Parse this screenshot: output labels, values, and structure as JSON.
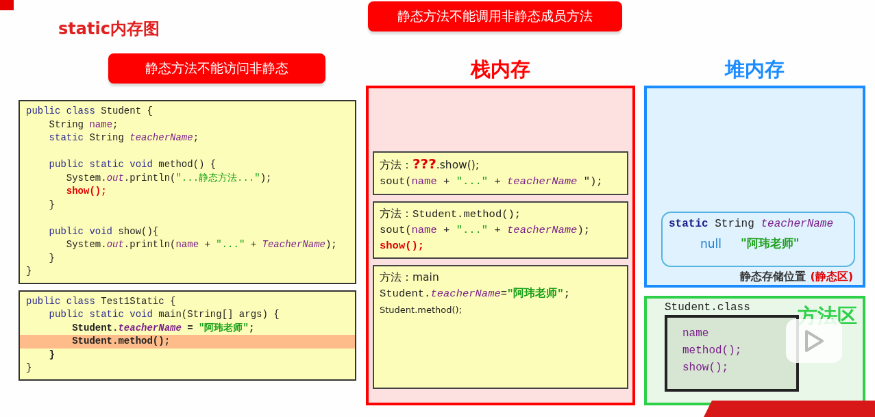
{
  "title": "static内存图",
  "left_banner": "静态方法不能访问非静态",
  "top_banner": "静态方法不能调用非静态成员方法",
  "code_blocks": [
    {
      "sections": [
        [
          {
            "highlighted": false,
            "tokens": [
              {
                "kind": "keyword",
                "text": "public class"
              },
              {
                "kind": "plain",
                "text": " Student {"
              }
            ]
          },
          {
            "highlighted": false,
            "tokens": [
              {
                "kind": "plain",
                "text": "    String "
              },
              {
                "kind": "field",
                "text": "name"
              },
              {
                "kind": "plain",
                "text": ";"
              }
            ]
          },
          {
            "highlighted": false,
            "tokens": [
              {
                "kind": "keyword",
                "text": "    static"
              },
              {
                "kind": "plain",
                "text": " String "
              },
              {
                "kind": "italic",
                "text": "teacherName"
              },
              {
                "kind": "plain",
                "text": ";"
              }
            ]
          }
        ],
        [
          {
            "highlighted": false,
            "tokens": [
              {
                "kind": "keyword",
                "text": "    public static void"
              },
              {
                "kind": "plain",
                "text": " method() {"
              }
            ]
          },
          {
            "highlighted": false,
            "tokens": [
              {
                "kind": "plain",
                "text": "       System."
              },
              {
                "kind": "italic",
                "text": "out"
              },
              {
                "kind": "plain",
                "text": ".println("
              },
              {
                "kind": "string",
                "text": "\"...静态方法...\""
              },
              {
                "kind": "plain",
                "text": ");"
              }
            ]
          },
          {
            "highlighted": false,
            "tokens": [
              {
                "kind": "error",
                "text": "       show();"
              }
            ]
          },
          {
            "highlighted": false,
            "tokens": [
              {
                "kind": "plain",
                "text": "    }"
              }
            ]
          }
        ],
        [
          {
            "highlighted": false,
            "tokens": [
              {
                "kind": "keyword",
                "text": "    public void"
              },
              {
                "kind": "plain",
                "text": " show(){"
              }
            ]
          },
          {
            "highlighted": false,
            "tokens": [
              {
                "kind": "plain",
                "text": "       System."
              },
              {
                "kind": "italic",
                "text": "out"
              },
              {
                "kind": "plain",
                "text": ".println("
              },
              {
                "kind": "field",
                "text": "name"
              },
              {
                "kind": "plain",
                "text": " + "
              },
              {
                "kind": "string",
                "text": "\"...\""
              },
              {
                "kind": "plain",
                "text": " + "
              },
              {
                "kind": "italic",
                "text": "TeacherName"
              },
              {
                "kind": "plain",
                "text": ");"
              }
            ]
          },
          {
            "highlighted": false,
            "tokens": [
              {
                "kind": "plain",
                "text": "    }"
              }
            ]
          },
          {
            "highlighted": false,
            "tokens": [
              {
                "kind": "plain",
                "text": "}"
              }
            ]
          }
        ]
      ]
    },
    {
      "sections": [
        [
          {
            "highlighted": false,
            "tokens": [
              {
                "kind": "keyword",
                "text": "public class"
              },
              {
                "kind": "plain",
                "text": " Test1Static {"
              }
            ]
          },
          {
            "highlighted": false,
            "tokens": [
              {
                "kind": "keyword",
                "text": "    public static void"
              },
              {
                "kind": "plain",
                "text": " main(String[] args) {"
              }
            ]
          },
          {
            "highlighted": false,
            "tokens": [
              {
                "kind": "bold",
                "text": "        Student."
              },
              {
                "kind": "bolditalic",
                "text": "teacherName"
              },
              {
                "kind": "bold",
                "text": " = "
              },
              {
                "kind": "boldstring",
                "text": "\"阿玮老师\""
              },
              {
                "kind": "bold",
                "text": ";"
              }
            ]
          },
          {
            "highlighted": true,
            "tokens": [
              {
                "kind": "bold",
                "text": "        Student.method();"
              }
            ]
          },
          {
            "highlighted": false,
            "tokens": [
              {
                "kind": "bold",
                "text": "    }"
              }
            ]
          },
          {
            "highlighted": false,
            "tokens": [
              {
                "kind": "plain",
                "text": "}"
              }
            ]
          }
        ]
      ]
    }
  ],
  "stack": {
    "title": "栈内存",
    "frames": [
      {
        "lines": [
          [
            {
              "kind": "sans",
              "text": "方法："
            },
            {
              "kind": "question",
              "text": "???"
            },
            {
              "kind": "sans",
              "text": ".show();"
            }
          ],
          [
            {
              "kind": "plain",
              "text": "sout("
            },
            {
              "kind": "field",
              "text": "name"
            },
            {
              "kind": "plain",
              "text": " + "
            },
            {
              "kind": "string",
              "text": "\"...\""
            },
            {
              "kind": "plain",
              "text": " + "
            },
            {
              "kind": "italic",
              "text": "teacherName"
            },
            {
              "kind": "plain",
              "text": " \");"
            }
          ]
        ]
      },
      {
        "lines": [
          [
            {
              "kind": "sans",
              "text": "方法："
            },
            {
              "kind": "plain",
              "text": "Student.method();"
            }
          ],
          [
            {
              "kind": "plain",
              "text": "sout("
            },
            {
              "kind": "field",
              "text": "name"
            },
            {
              "kind": "plain",
              "text": " + "
            },
            {
              "kind": "string",
              "text": "\"...\""
            },
            {
              "kind": "plain",
              "text": " + "
            },
            {
              "kind": "italic",
              "text": "teacherName"
            },
            {
              "kind": "plain",
              "text": ");"
            }
          ],
          [
            {
              "kind": "error",
              "text": "show();"
            }
          ]
        ]
      },
      {
        "lines": [
          [
            {
              "kind": "sans",
              "text": "方法：main"
            }
          ],
          [
            {
              "kind": "plain",
              "text": "Student."
            },
            {
              "kind": "italic",
              "text": "teacherName"
            },
            {
              "kind": "plain",
              "text": "="
            },
            {
              "kind": "boldstring",
              "text": "\"阿玮老师\""
            },
            {
              "kind": "plain",
              "text": ";"
            }
          ],
          [
            {
              "kind": "small",
              "text": "Student.method();"
            }
          ]
        ]
      }
    ]
  },
  "heap": {
    "title": "堆内存",
    "static_field": [
      {
        "kind": "keyword",
        "text": "static"
      },
      {
        "kind": "plain",
        "text": " String "
      },
      {
        "kind": "italic",
        "text": "teacherName"
      }
    ],
    "values": [
      {
        "kind": "old",
        "text": "null"
      },
      {
        "kind": "current",
        "text": "\"阿玮老师\""
      }
    ],
    "caption": "静态存储位置",
    "caption_note": "(静态区)"
  },
  "method_area": {
    "title": "方法区",
    "class_name": "Student.class",
    "members": [
      "name",
      "method();",
      "show();"
    ]
  }
}
